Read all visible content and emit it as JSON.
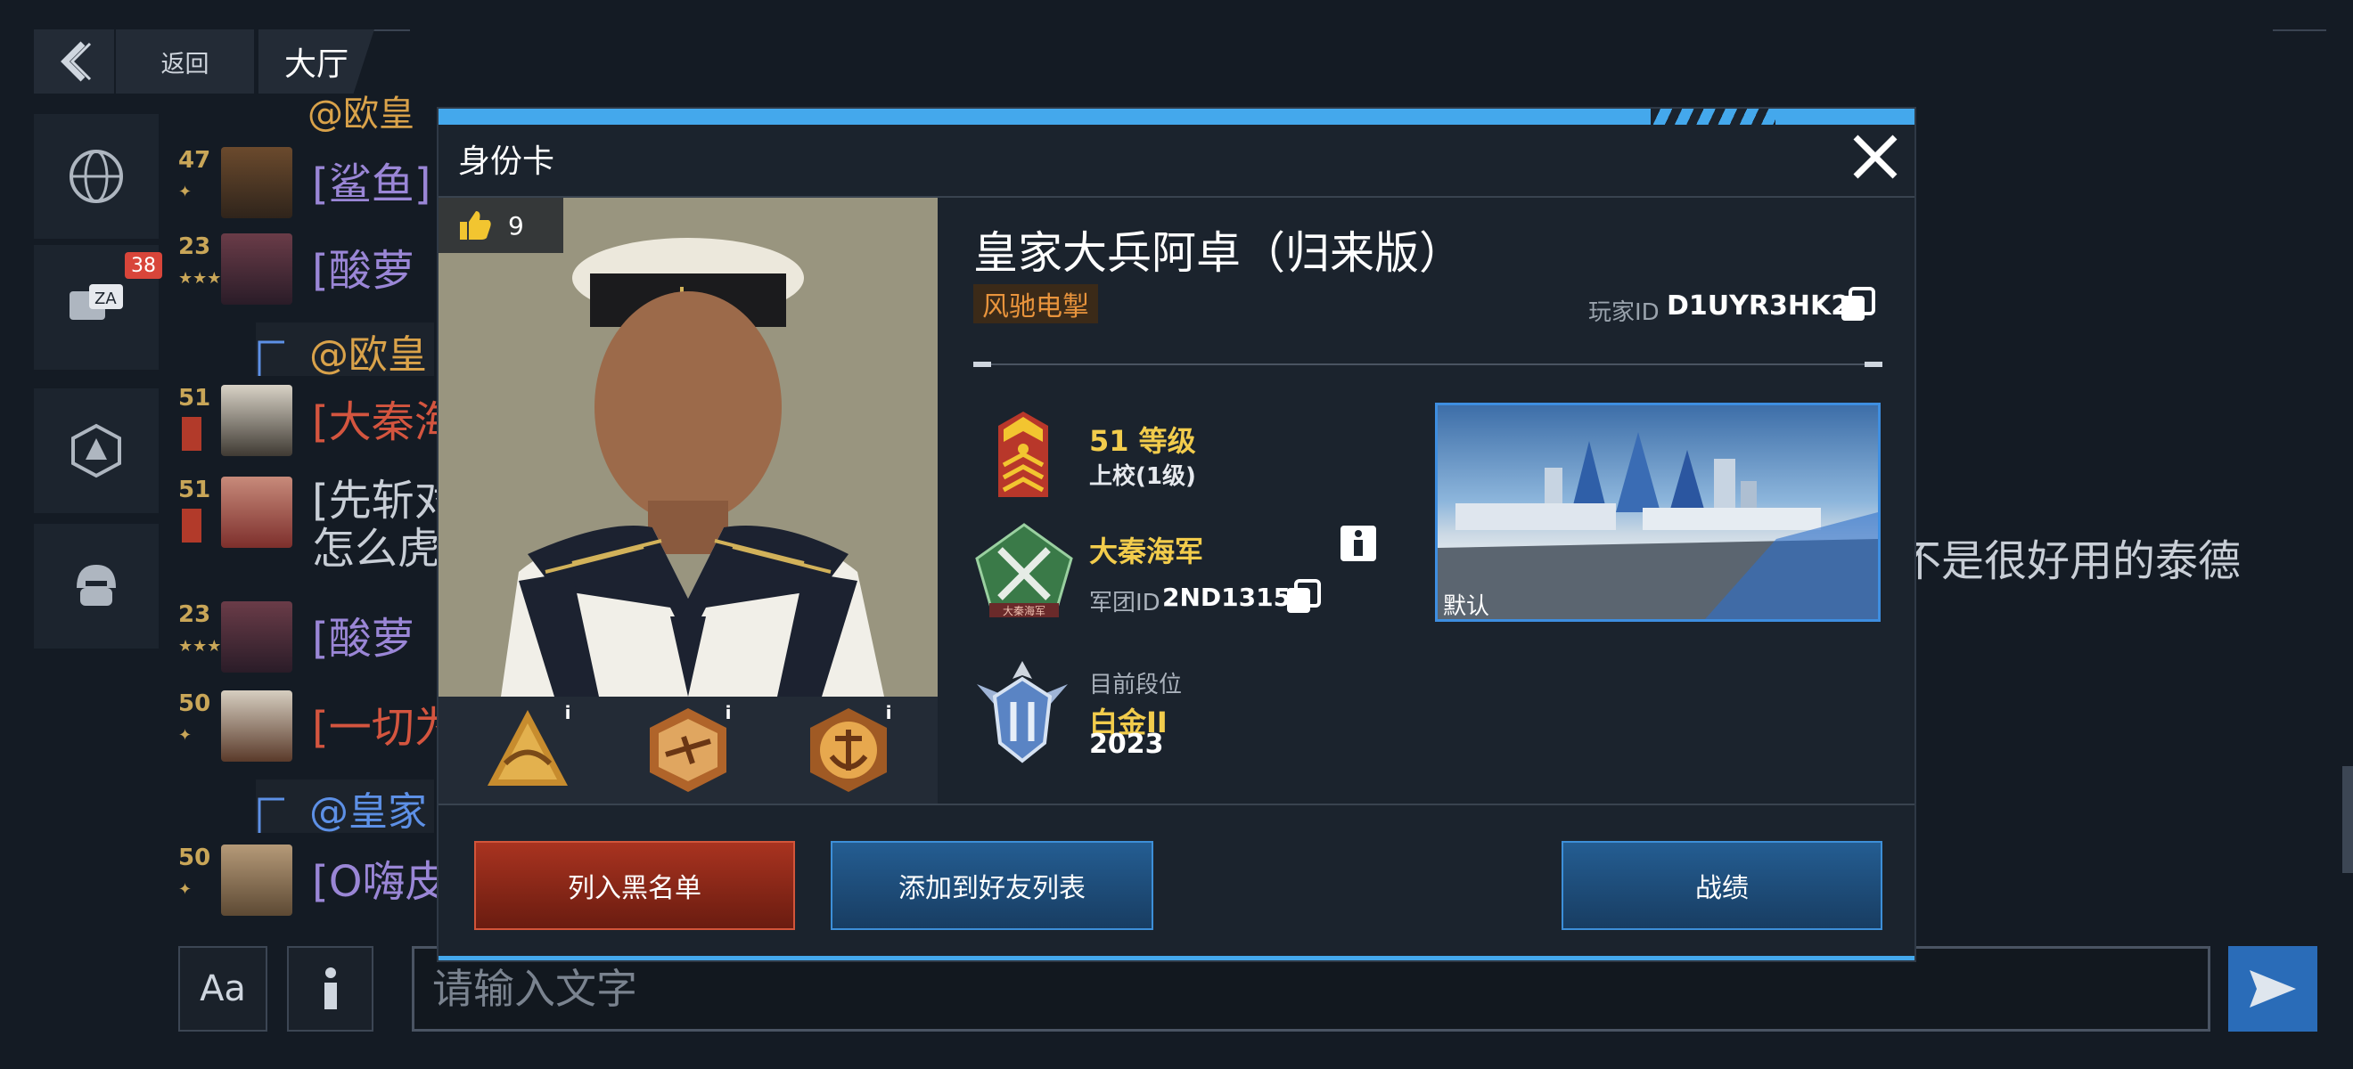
{
  "topbar": {
    "back_label": "返回",
    "title": "大厅"
  },
  "nav": {
    "badge_count": "38"
  },
  "chat": {
    "rows": [
      {
        "level": "47",
        "text": "[鲨鱼]",
        "color": "purple"
      },
      {
        "level": "23",
        "text": "[酸萝 卜",
        "color": "purple"
      },
      {
        "mention": "@欧皇",
        "color": "orange"
      },
      {
        "level": "51",
        "text": "[大秦海",
        "color": "red"
      },
      {
        "level": "51",
        "text": "[先斩对",
        "text2": "怎么虎",
        "color": "grey"
      },
      {
        "level": "23",
        "text": "[酸萝 卜",
        "color": "purple"
      },
      {
        "level": "50",
        "text": "[一切为",
        "color": "red"
      },
      {
        "mention": "@皇家",
        "color": "blue"
      },
      {
        "level": "50",
        "text": "[O嗨皮",
        "color": "purple"
      }
    ],
    "top_cut_text": "@欧皇",
    "right_message": "不是很好用的泰德",
    "input_placeholder": "请输入文字",
    "aa_label": "Aa"
  },
  "modal": {
    "title": "身份卡",
    "likes": "9",
    "player_name": "皇家大兵阿卓（归来版）",
    "title_badge": "风驰电掣",
    "player_id_label": "玩家ID",
    "player_id": "D1UYR3HK2",
    "level_text": "51 等级",
    "rank_text": "上校(1级)",
    "legion_name": "大秦海军",
    "legion_id_label": "军团ID",
    "legion_id": "2ND13151",
    "legion_emblem_text": "大秦海军",
    "segment_label": "目前段位",
    "segment_name": "白金II",
    "segment_points": "2023",
    "map_label": "默认",
    "btn_blacklist": "列入黑名单",
    "btn_add_friend": "添加到好友列表",
    "btn_record": "战绩"
  },
  "colors": {
    "accent": "#44a8ec",
    "gold": "#f2cc4c",
    "danger": "#d2553a",
    "badge": "#e9943c"
  }
}
